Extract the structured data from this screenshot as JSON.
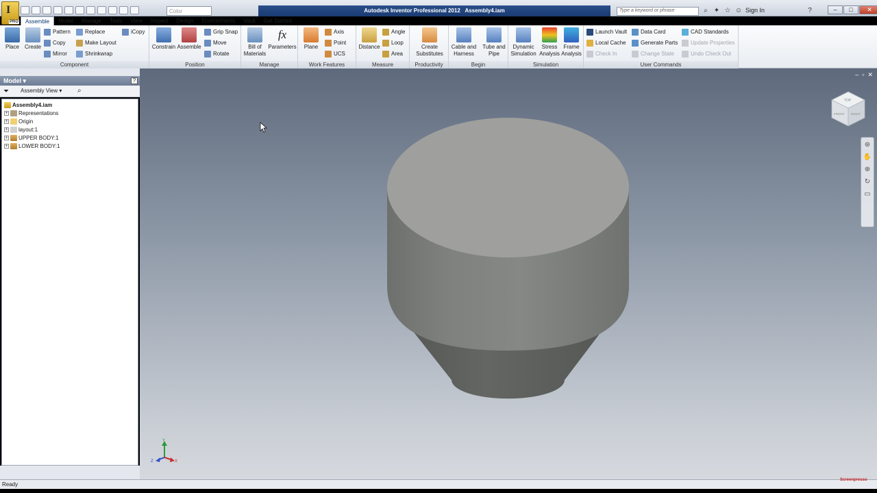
{
  "titlebar": {
    "app_title": "Autodesk Inventor Professional 2012",
    "document": "Assembly4.iam",
    "color_placeholder": "Color",
    "search_placeholder": "Type a keyword or phrase",
    "signin_label": "Sign In",
    "logo_letter": "I",
    "logo_badge": "PRO"
  },
  "tabs": [
    "Assemble",
    "Model",
    "Manage",
    "Tools",
    "View",
    "Inspect",
    "Design",
    "Environments",
    "Vault",
    "Get Started"
  ],
  "ribbon": {
    "component": {
      "label": "Component",
      "place": "Place",
      "create": "Create",
      "pattern": "Pattern",
      "copy": "Copy",
      "mirror": "Mirror",
      "replace": "Replace",
      "make_layout": "Make Layout",
      "shrinkwrap": "Shrinkwrap",
      "icopy": "iCopy"
    },
    "position": {
      "label": "Position",
      "constrain": "Constrain",
      "assemble": "Assemble",
      "grip_snap": "Grip Snap",
      "move": "Move",
      "rotate": "Rotate"
    },
    "manage": {
      "label": "Manage",
      "bom_l1": "Bill of",
      "bom_l2": "Materials",
      "parameters": "Parameters",
      "fx": "fx"
    },
    "work_features": {
      "label": "Work Features",
      "plane": "Plane",
      "axis": "Axis",
      "point": "Point",
      "ucs": "UCS"
    },
    "measure": {
      "label": "Measure",
      "distance": "Distance",
      "angle": "Angle",
      "loop": "Loop",
      "area": "Area"
    },
    "productivity": {
      "label": "Productivity",
      "cs_l1": "Create",
      "cs_l2": "Substitutes"
    },
    "begin": {
      "label": "Begin",
      "cable_l1": "Cable and",
      "cable_l2": "Harness",
      "tube_l1": "Tube and",
      "tube_l2": "Pipe"
    },
    "simulation": {
      "label": "Simulation",
      "dyn_l1": "Dynamic",
      "dyn_l2": "Simulation",
      "stress_l1": "Stress",
      "stress_l2": "Analysis",
      "frame_l1": "Frame",
      "frame_l2": "Analysis"
    },
    "user_commands": {
      "label": "User Commands",
      "launch_vault": "Launch Vault",
      "local_cache": "Local Cache",
      "check_in": "Check In",
      "data_card": "Data Card",
      "generate_parts": "Generate Parts",
      "change_state": "Change State",
      "cad_standards": "CAD Standards",
      "update_properties": "Update Properties",
      "undo_checkout": "Undo Check Out"
    }
  },
  "browser": {
    "title": "Model",
    "view_label": "Assembly View",
    "help": "?",
    "root": "Assembly4.iam",
    "nodes": [
      "Representations",
      "Origin",
      "layout:1",
      "UPPER BODY:1",
      "LOWER BODY:1"
    ]
  },
  "viewcube": {
    "face_top": "TOP",
    "face_front": "FRONT",
    "face_right": "RIGHT"
  },
  "triad": {
    "x": "X",
    "y": "Y",
    "z": "Z"
  },
  "status": {
    "text": "Ready"
  },
  "watermark": "Screenpresso",
  "colors": {
    "title_blue": "#1a3a72",
    "model_top": "#9fa09d",
    "model_side": "#7b7c7a",
    "model_cone": "#5f605d"
  }
}
